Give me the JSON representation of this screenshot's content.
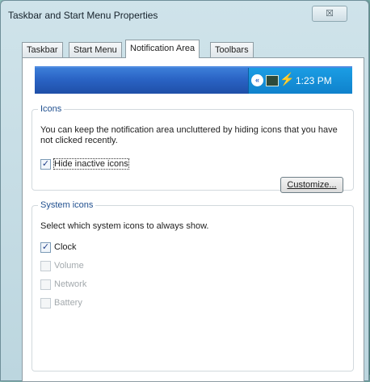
{
  "window": {
    "title": "Taskbar and Start Menu Properties",
    "close_glyph": "☒"
  },
  "tabs": [
    {
      "label": "Taskbar"
    },
    {
      "label": "Start Menu"
    },
    {
      "label": "Notification Area"
    },
    {
      "label": "Toolbars"
    }
  ],
  "preview": {
    "chevron_glyph": "«",
    "icon2_glyph": "⚡",
    "time": "1:23 PM"
  },
  "icons_group": {
    "legend": "Icons",
    "description": "You can keep the notification area uncluttered by hiding icons that you have not clicked recently.",
    "hide_inactive": {
      "label": "Hide inactive icons",
      "checked": true,
      "check_glyph": "✓"
    },
    "customize_label": "Customize..."
  },
  "system_group": {
    "legend": "System icons",
    "description": "Select which system icons to always show.",
    "check_glyph": "✓",
    "items": [
      {
        "label": "Clock",
        "checked": true,
        "enabled": true
      },
      {
        "label": "Volume",
        "checked": false,
        "enabled": false
      },
      {
        "label": "Network",
        "checked": false,
        "enabled": false
      },
      {
        "label": "Battery",
        "checked": false,
        "enabled": false
      }
    ]
  }
}
